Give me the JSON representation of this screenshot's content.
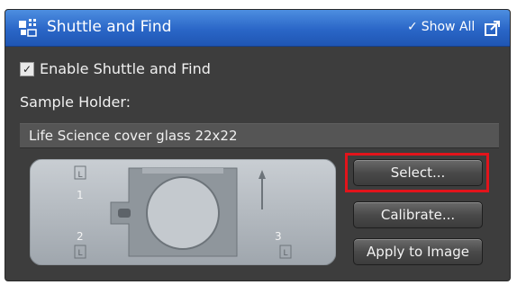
{
  "header": {
    "title": "Shuttle and Find",
    "show_all_label": "Show All",
    "accent_color": "#2a66c7"
  },
  "enable": {
    "label": "Enable Shuttle and Find",
    "checked": true
  },
  "sample_holder": {
    "label": "Sample Holder:",
    "value": "Life Science cover glass 22x22"
  },
  "preview": {
    "markers": [
      "1",
      "2",
      "3"
    ],
    "marker_letter": "L"
  },
  "buttons": {
    "select": "Select...",
    "calibrate": "Calibrate...",
    "apply": "Apply to Image"
  },
  "highlight_color": "#e2141b"
}
